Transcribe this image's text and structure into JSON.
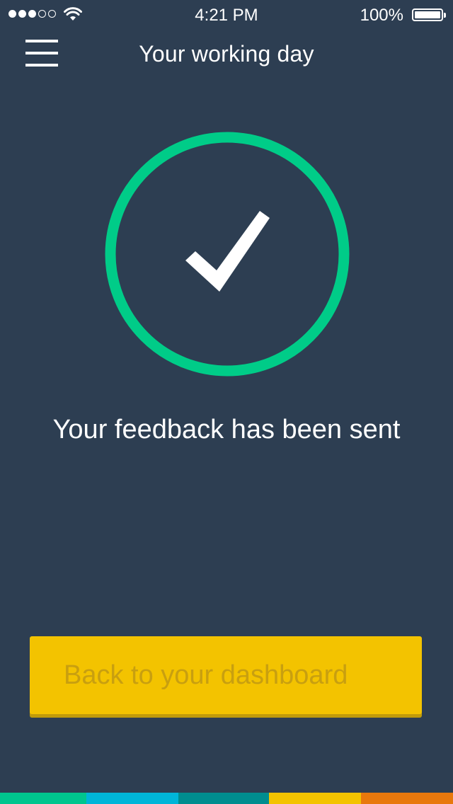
{
  "status_bar": {
    "time": "4:21 PM",
    "battery_percent": "100%",
    "signal_bars": 3,
    "signal_total": 5
  },
  "nav": {
    "title": "Your working day",
    "menu_icon": "hamburger-menu-icon"
  },
  "confirmation": {
    "icon": "checkmark-circle-icon",
    "ring_color": "#00cc88",
    "check_color": "#ffffff",
    "message": "Your feedback has been sent"
  },
  "dashboard_button": {
    "label": "Back to your dashboard",
    "color": "#f3c300"
  },
  "footer_colors": [
    "#00c58e",
    "#00b5d8",
    "#008d8f",
    "#f3c300",
    "#e8780c"
  ],
  "colors": {
    "background": "#2d3e52"
  }
}
